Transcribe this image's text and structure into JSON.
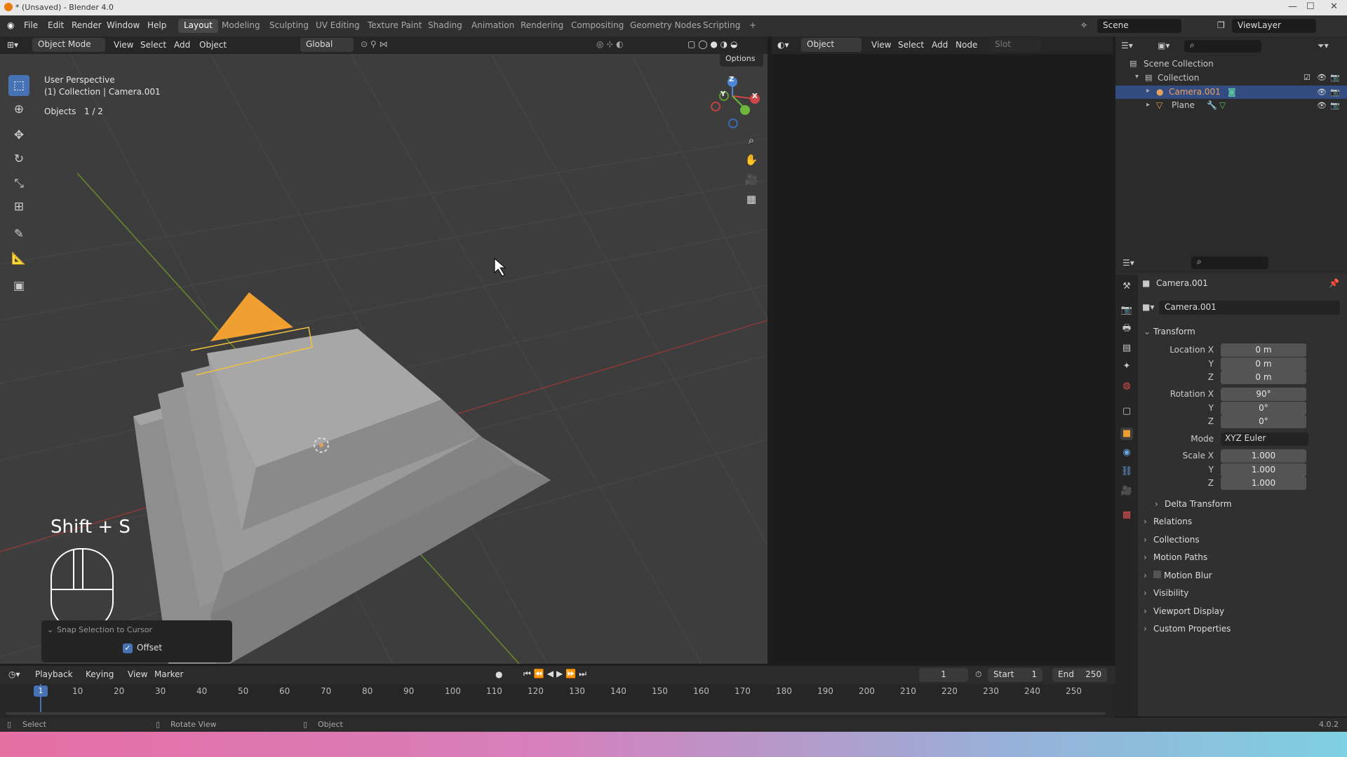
{
  "window": {
    "title": "* (Unsaved) - Blender 4.0"
  },
  "topbar": {
    "menus": [
      "File",
      "Edit",
      "Render",
      "Window",
      "Help"
    ],
    "workspaces": [
      "Layout",
      "Modeling",
      "Sculpting",
      "UV Editing",
      "Texture Paint",
      "Shading",
      "Animation",
      "Rendering",
      "Compositing",
      "Geometry Nodes",
      "Scripting",
      "+"
    ],
    "scene": "Scene",
    "view_layer": "ViewLayer"
  },
  "viewport": {
    "mode": "Object Mode",
    "menus": [
      "View",
      "Select",
      "Add",
      "Object"
    ],
    "orientation": "Global",
    "options": "Options",
    "perspective": "User Perspective",
    "collection_info": "(1) Collection | Camera.001",
    "objects_label": "Objects",
    "objects_count": "1 / 2",
    "shortcut": "Shift + S",
    "snap_panel_title": "Snap Selection to Cursor",
    "snap_offset_label": "Offset",
    "gizmo_axes": [
      "X",
      "Y",
      "Z"
    ]
  },
  "node_editor": {
    "mode": "Object",
    "menus": [
      "View",
      "Select",
      "Add",
      "Node"
    ],
    "slot": "Slot"
  },
  "outliner": {
    "root": "Scene Collection",
    "collection": "Collection",
    "items": [
      {
        "name": "Camera.001",
        "selected": true
      },
      {
        "name": "Plane",
        "selected": false
      }
    ]
  },
  "properties": {
    "object_name": "Camera.001",
    "object_field": "Camera.001",
    "transform_title": "Transform",
    "labels": {
      "location_x": "Location X",
      "rotation_x": "Rotation X",
      "scale_x": "Scale X",
      "y": "Y",
      "z": "Z",
      "mode": "Mode"
    },
    "location": [
      "0 m",
      "0 m",
      "0 m"
    ],
    "rotation": [
      "90°",
      "0°",
      "0°"
    ],
    "rotation_mode": "XYZ Euler",
    "scale": [
      "1.000",
      "1.000",
      "1.000"
    ],
    "sections": [
      "Delta Transform",
      "Relations",
      "Collections",
      "Motion Paths",
      "Motion Blur",
      "Visibility",
      "Viewport Display",
      "Custom Properties"
    ]
  },
  "timeline": {
    "menus": [
      "Playback",
      "Keying",
      "View",
      "Marker"
    ],
    "current_frame": "1",
    "start_label": "Start",
    "start": "1",
    "end_label": "End",
    "end": "250",
    "ticks": [
      "1",
      "10",
      "20",
      "30",
      "40",
      "50",
      "60",
      "70",
      "80",
      "90",
      "100",
      "110",
      "120",
      "130",
      "140",
      "150",
      "160",
      "170",
      "180",
      "190",
      "200",
      "210",
      "220",
      "230",
      "240",
      "250"
    ]
  },
  "statusbar": {
    "select": "Select",
    "rotate": "Rotate View",
    "object": "Object",
    "version": "4.0.2"
  },
  "colors": {
    "accent": "#4772b3",
    "camera": "#f0a030",
    "selection": "#f0c040"
  }
}
